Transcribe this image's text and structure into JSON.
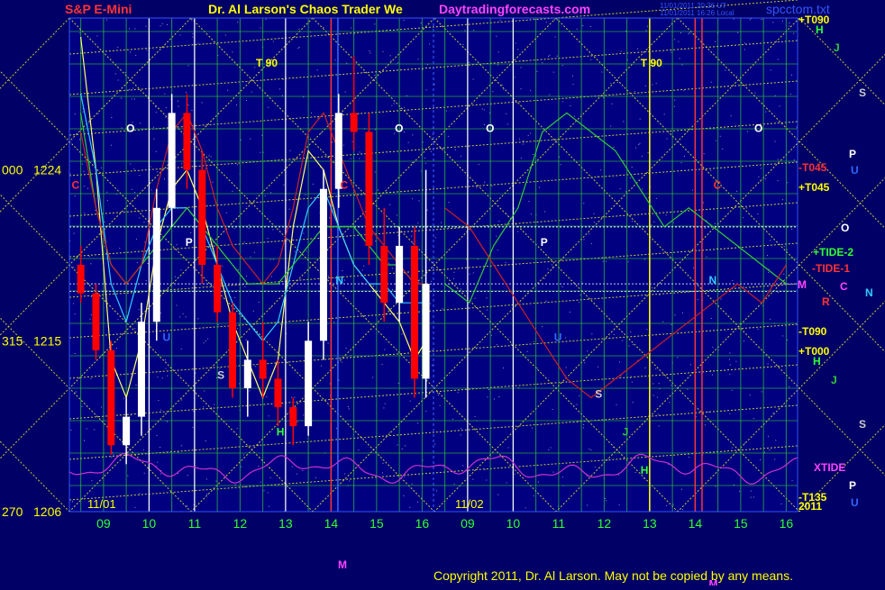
{
  "header": {
    "instrument": "S&P E-Mini",
    "title": "Dr. Al Larson's Chaos Trader We",
    "site": "Daytradingforecasts.com",
    "timestamp1": "11/01/2011 20:26 UT",
    "timestamp2": "11/01/2011 16:26 Local",
    "filename": "spcctom.txt"
  },
  "footer": {
    "copyright": "Copyright 2011, Dr. Al Larson. May not be copied by any means."
  },
  "colors": {
    "background": "#000066",
    "plot_background": "#000080",
    "price_up": "#ffffff",
    "price_down": "#ff0000",
    "grid": "#33cc33",
    "diagonal": "#cccc33",
    "xtide": "#cc33cc"
  },
  "chart_data": {
    "type": "candlestick",
    "title": "S&P E-Mini",
    "y_axis": {
      "ticks": [
        {
          "label": "000",
          "value": "1224"
        },
        {
          "label": "315",
          "value": "1215"
        },
        {
          "label": "270",
          "value": "1206"
        }
      ],
      "ylim": [
        1206,
        1232
      ]
    },
    "x_axis": {
      "dates": [
        "11/01",
        "11/02"
      ],
      "hours": [
        "09",
        "10",
        "11",
        "12",
        "13",
        "14",
        "15",
        "16",
        "09",
        "10",
        "11",
        "12",
        "13",
        "14",
        "15",
        "16"
      ]
    },
    "day_markers": [
      "T 90",
      "T 90"
    ],
    "right_labels": [
      {
        "text": "+T090",
        "color": "#ffff00"
      },
      {
        "text": "-T045",
        "color": "#ff3333"
      },
      {
        "text": "+T045",
        "color": "#ffff00"
      },
      {
        "text": "+TIDE-2",
        "color": "#33ff33"
      },
      {
        "text": "-TIDE-1",
        "color": "#ff3333"
      },
      {
        "text": "-T090",
        "color": "#ffff00"
      },
      {
        "text": "+T000",
        "color": "#ffff00"
      },
      {
        "text": "XTIDE",
        "color": "#ff44ff"
      },
      {
        "text": "-T135",
        "color": "#ffff00"
      },
      {
        "text": "2011",
        "color": "#ffff00"
      }
    ],
    "planet_labels": [
      "H",
      "J",
      "S",
      "P",
      "U",
      "O",
      "M",
      "C",
      "N",
      "R",
      "H",
      "J",
      "S",
      "P",
      "U"
    ],
    "flux_letters": [
      "O",
      "C",
      "P",
      "U",
      "S",
      "H",
      "M",
      "N",
      "O",
      "C",
      "O",
      "P",
      "U",
      "S",
      "J",
      "H",
      "M",
      "N",
      "O",
      "C"
    ],
    "price_series": [
      {
        "time": "08:30",
        "open": 1219,
        "high": 1220,
        "low": 1217,
        "close": 1217.5
      },
      {
        "time": "08:50",
        "open": 1217.5,
        "high": 1218,
        "low": 1214,
        "close": 1214.5
      },
      {
        "time": "09:10",
        "open": 1214.5,
        "high": 1215,
        "low": 1209,
        "close": 1209.5
      },
      {
        "time": "09:30",
        "open": 1209.5,
        "high": 1212,
        "low": 1208.5,
        "close": 1211
      },
      {
        "time": "09:50",
        "open": 1211,
        "high": 1217,
        "low": 1210,
        "close": 1216
      },
      {
        "time": "10:10",
        "open": 1216,
        "high": 1223,
        "low": 1215,
        "close": 1222
      },
      {
        "time": "10:30",
        "open": 1222,
        "high": 1228,
        "low": 1221,
        "close": 1227
      },
      {
        "time": "10:50",
        "open": 1227,
        "high": 1228,
        "low": 1223,
        "close": 1224
      },
      {
        "time": "11:10",
        "open": 1224,
        "high": 1225,
        "low": 1218,
        "close": 1219
      },
      {
        "time": "11:30",
        "open": 1219,
        "high": 1220,
        "low": 1216,
        "close": 1216.5
      },
      {
        "time": "11:50",
        "open": 1216.5,
        "high": 1217,
        "low": 1212,
        "close": 1212.5
      },
      {
        "time": "12:10",
        "open": 1212.5,
        "high": 1215,
        "low": 1211,
        "close": 1214
      },
      {
        "time": "12:30",
        "open": 1214,
        "high": 1216,
        "low": 1212,
        "close": 1213
      },
      {
        "time": "12:50",
        "open": 1213,
        "high": 1214,
        "low": 1210.5,
        "close": 1211.5
      },
      {
        "time": "13:10",
        "open": 1211.5,
        "high": 1212,
        "low": 1209.5,
        "close": 1210.5
      },
      {
        "time": "13:30",
        "open": 1210.5,
        "high": 1216,
        "low": 1210,
        "close": 1215
      },
      {
        "time": "13:50",
        "open": 1215,
        "high": 1224,
        "low": 1214,
        "close": 1223
      },
      {
        "time": "14:10",
        "open": 1223,
        "high": 1228,
        "low": 1222,
        "close": 1227
      },
      {
        "time": "14:30",
        "open": 1227,
        "high": 1230,
        "low": 1225,
        "close": 1226
      },
      {
        "time": "14:50",
        "open": 1226,
        "high": 1227,
        "low": 1219,
        "close": 1220
      },
      {
        "time": "15:10",
        "open": 1220,
        "high": 1222,
        "low": 1216,
        "close": 1217
      },
      {
        "time": "15:30",
        "open": 1217,
        "high": 1221,
        "low": 1216,
        "close": 1220
      },
      {
        "time": "15:50",
        "open": 1220,
        "high": 1221,
        "low": 1212,
        "close": 1213
      },
      {
        "time": "16:05",
        "open": 1213,
        "high": 1224,
        "low": 1212,
        "close": 1218
      }
    ],
    "average_lines": [
      {
        "color": "#ffff66",
        "values": [
          1231,
          1224,
          1214,
          1212,
          1215,
          1220,
          1223,
          1224,
          1222,
          1219,
          1216,
          1214,
          1212,
          1214,
          1221,
          1225,
          1224,
          1221,
          1219,
          1218,
          1217,
          1216,
          1214,
          1215
        ]
      },
      {
        "color": "#33ccff",
        "values": [
          1228,
          1224,
          1218,
          1216,
          1219,
          1221,
          1222,
          1222,
          1221,
          1219,
          1217,
          1216,
          1215,
          1216,
          1219,
          1222,
          1223,
          1221,
          1219,
          1218,
          1218,
          1217,
          1217,
          1217
        ]
      },
      {
        "color": "#33cc33",
        "values": [
          1227,
          1222,
          1219,
          1218,
          1219,
          1220,
          1221,
          1222,
          1221,
          1220,
          1219,
          1218,
          1218,
          1218,
          1219,
          1220,
          1221,
          1221,
          1221,
          1220,
          1219,
          1219,
          1218,
          1218
        ]
      },
      {
        "color": "#cc2222",
        "values": [
          1226,
          1222,
          1219,
          1218,
          1219,
          1223,
          1226,
          1227,
          1225,
          1222,
          1220,
          1219,
          1218,
          1219,
          1222,
          1226,
          1227,
          1225,
          1223,
          1221,
          1220,
          1219,
          1218,
          1218
        ]
      }
    ],
    "forecast_lines": [
      {
        "color": "#33cc33",
        "values": [
          1218,
          1217,
          1220,
          1222,
          1226,
          1227,
          1226,
          1225,
          1223,
          1221,
          1222,
          1221,
          1220,
          1219,
          1218
        ]
      },
      {
        "color": "#cc2222",
        "values": [
          1222,
          1221,
          1219,
          1217,
          1215,
          1213,
          1212,
          1213,
          1214,
          1215,
          1216,
          1217,
          1218,
          1217,
          1219
        ]
      }
    ]
  }
}
